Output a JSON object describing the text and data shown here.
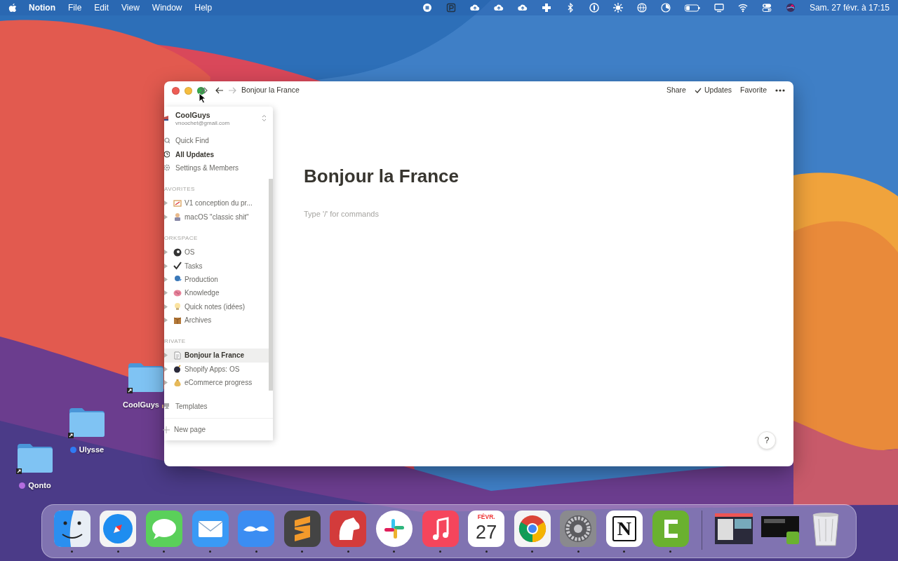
{
  "menu_bar": {
    "app": "Notion",
    "menus": [
      "File",
      "Edit",
      "View",
      "Window",
      "Help"
    ],
    "clock": "Sam. 27 févr. à  17:15"
  },
  "desktop_icons": [
    {
      "label": "CoolGuys"
    },
    {
      "label": "Ulysse",
      "color": "#2f7bf5"
    },
    {
      "label": "Qonto",
      "color": "#b46ddf"
    }
  ],
  "window": {
    "breadcrumb": "Bonjour la France",
    "actions": [
      "Share",
      "Updates",
      "Favorite"
    ],
    "page_title": "Bonjour la France",
    "placeholder": "Type '/' for commands",
    "help": "?"
  },
  "sidebar": {
    "workspace": {
      "name": "CoolGuys",
      "email": "vnoochet@gmail.com"
    },
    "actions": [
      {
        "label": "Quick Find",
        "unread": false
      },
      {
        "label": "All Updates",
        "unread": true
      },
      {
        "label": "Settings & Members",
        "unread": false
      }
    ],
    "sections": [
      {
        "title": "AVORITES",
        "pages": [
          {
            "label": "V1 conception du pr...",
            "selected": false
          },
          {
            "label": "macOS \"classic shit\"",
            "selected": false
          }
        ]
      },
      {
        "title": "ORKSPACE",
        "pages": [
          {
            "label": "OS",
            "selected": false
          },
          {
            "label": "Tasks",
            "selected": false
          },
          {
            "label": "Production",
            "selected": false
          },
          {
            "label": "Knowledge",
            "selected": false
          },
          {
            "label": "Quick notes (idées)",
            "selected": false
          },
          {
            "label": "Archives",
            "selected": false
          }
        ]
      },
      {
        "title": "RIVATE",
        "pages": [
          {
            "label": "Bonjour la France",
            "selected": true
          },
          {
            "label": "Shopify Apps: OS",
            "selected": false
          },
          {
            "label": "eCommerce progress",
            "selected": false
          }
        ]
      }
    ],
    "templates": "Templates",
    "new_page": "New page"
  },
  "dock": {
    "items": [
      {
        "running": true
      },
      {
        "running": true
      },
      {
        "running": true
      },
      {
        "running": true
      },
      {
        "running": true
      },
      {
        "running": true
      },
      {
        "running": true
      },
      {
        "running": true
      },
      {
        "running": true
      },
      {
        "running": true,
        "month": "FÉVR.",
        "day": "27"
      },
      {
        "running": true
      },
      {
        "running": true
      },
      {
        "running": true,
        "letter": "N"
      },
      {
        "running": true
      }
    ]
  }
}
